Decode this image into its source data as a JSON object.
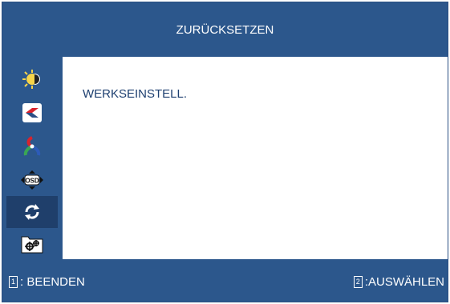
{
  "header": {
    "title": "ZURÜCKSETZEN"
  },
  "sidebar": {
    "items": [
      {
        "icon": "brightness-contrast-icon"
      },
      {
        "icon": "image-adjust-icon"
      },
      {
        "icon": "color-icon"
      },
      {
        "icon": "osd-settings-icon",
        "label": "OSD"
      },
      {
        "icon": "reset-icon",
        "selected": true
      },
      {
        "icon": "extra-settings-icon"
      }
    ]
  },
  "content": {
    "option": "WERKSEINSTELL."
  },
  "footer": {
    "left_key": "1",
    "left_label": ": BEENDEN",
    "right_key": "2",
    "right_label": ":AUSWÄHLEN"
  },
  "colors": {
    "panel": "#2c578c",
    "selected": "#1f3f6b",
    "text_dark": "#1d3f70"
  }
}
